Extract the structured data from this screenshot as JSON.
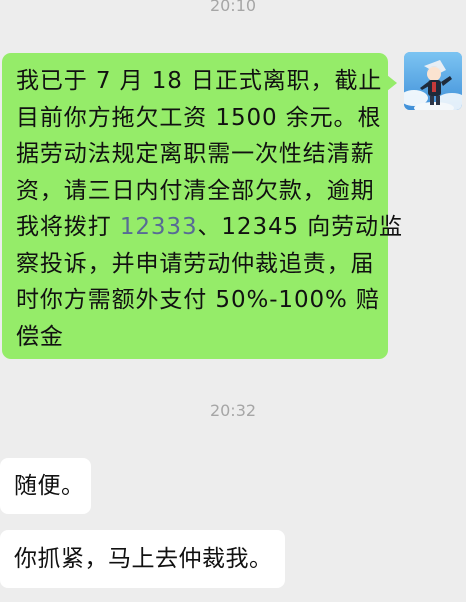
{
  "conversation": {
    "timestamp_1": "20:10",
    "sent_message": {
      "lines_before_link": [
        "我已于 7 月 18 日正式离职，截止",
        "目前你方拖欠工资 1500 余元。根",
        "据劳动法规定离职需一次性结清薪",
        "资，请三日内付清全部欠款，逾期"
      ],
      "link_line_prefix": "我将拨打 ",
      "phone_link": "12333",
      "link_line_suffix": "、12345 向劳动监",
      "lines_after_link": [
        "察投诉，并申请劳动仲裁追责，届",
        "时你方需额外支付 50%-100% 赔",
        "偿金"
      ]
    },
    "timestamp_2": "20:32",
    "received_messages": [
      "随便。",
      "你抓紧，马上去仲裁我。"
    ]
  },
  "avatar_icon": "anime-character-avatar-icon",
  "colors": {
    "background": "#ededed",
    "sent_bubble": "#95ec69",
    "received_bubble": "#ffffff",
    "link": "#576b95",
    "timestamp": "#a6a6a6"
  }
}
